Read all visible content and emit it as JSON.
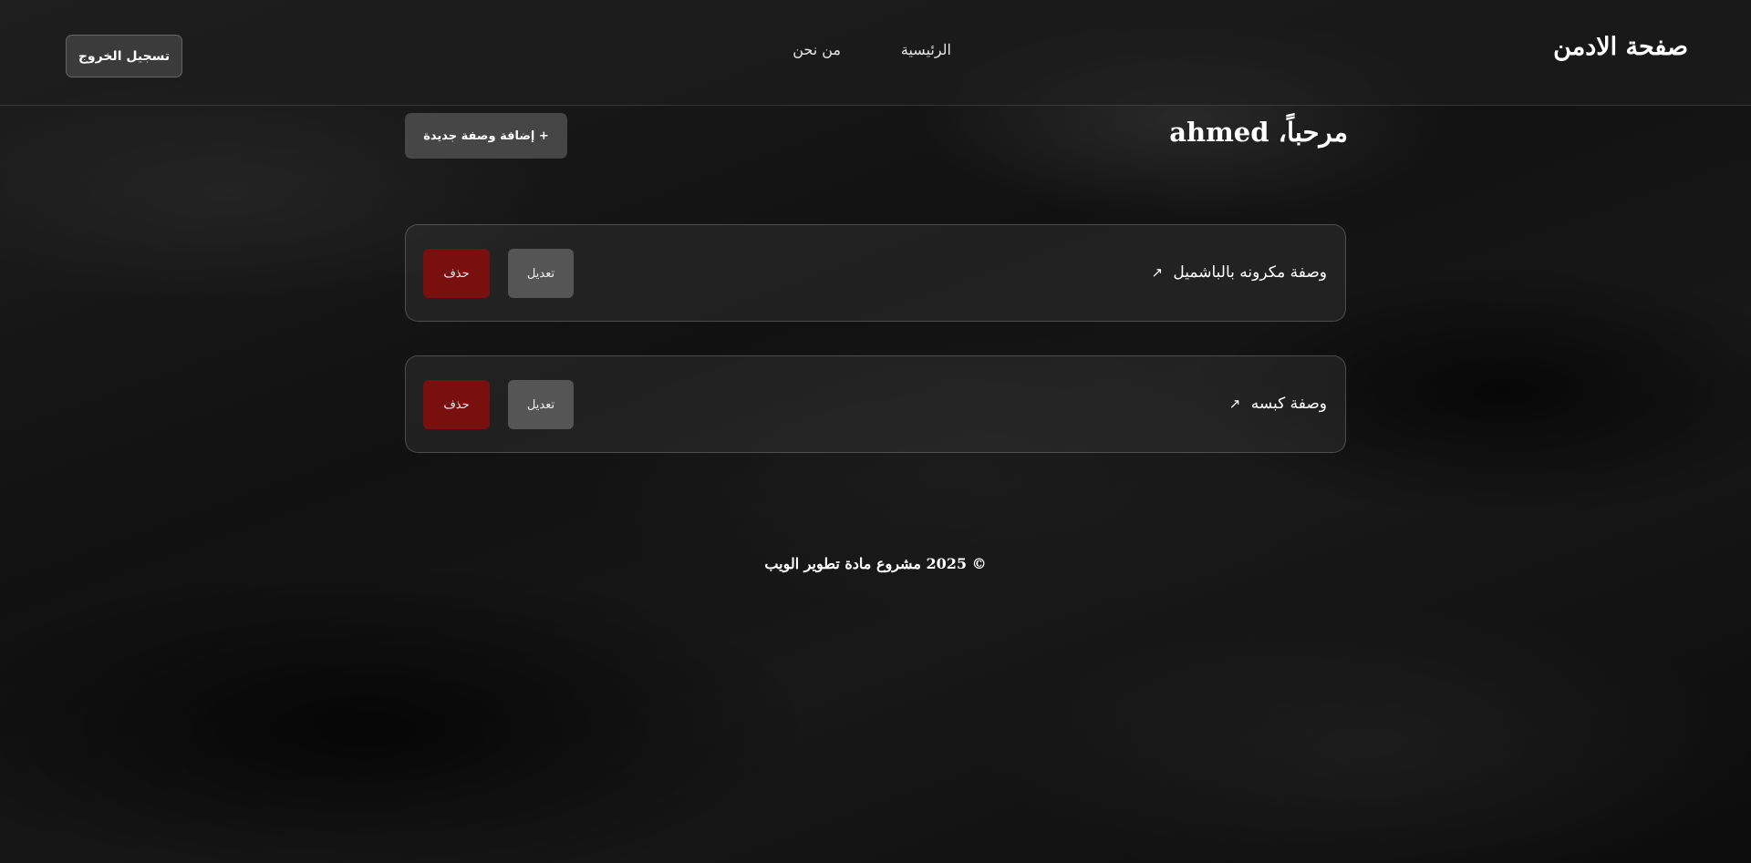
{
  "header": {
    "title": "صفحة الادمن",
    "nav": {
      "home": "الرئيسية",
      "about": "من نحن"
    },
    "logout_label": "تسجيل الخروج"
  },
  "main": {
    "welcome": "مرحباً، ahmed",
    "add_recipe_label": "+ إضافة وصفة جديدة",
    "recipes": [
      {
        "title": "وصفة مكرونه بالباشميل",
        "arrow": "↗",
        "edit_label": "تعديل",
        "delete_label": "حذف"
      },
      {
        "title": "وصفة كبسه",
        "arrow": "↗",
        "edit_label": "تعديل",
        "delete_label": "حذف"
      }
    ]
  },
  "footer": {
    "text": "© 2025 مشروع مادة تطوير الويب"
  },
  "colors": {
    "delete": "#7a0f0f",
    "edit": "#555555",
    "background": "#141414"
  }
}
